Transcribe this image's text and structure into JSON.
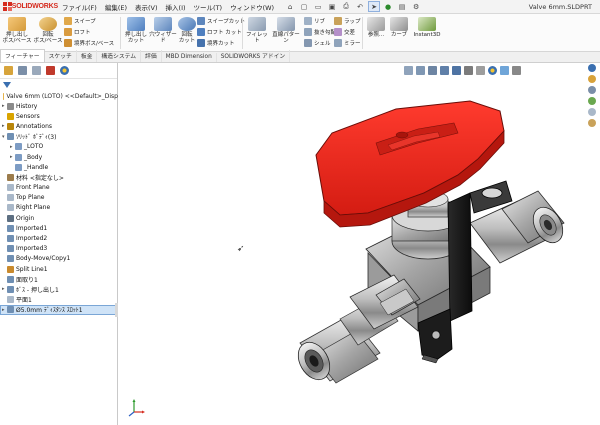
{
  "app": {
    "logo_text": "SOLIDWORKS",
    "window_title": "Valve 6mm.SLDPRT"
  },
  "menu": [
    {
      "label": "ファイル(F)"
    },
    {
      "label": "編集(E)"
    },
    {
      "label": "表示(V)"
    },
    {
      "label": "挿入(I)"
    },
    {
      "label": "ツール(T)"
    },
    {
      "label": "ウィンドウ(W)"
    }
  ],
  "ribbon": {
    "extrude_boss": "押し出し\nボス/ベース",
    "revolve_boss": "回転\nボス/ベース",
    "sweep": "スイープ",
    "loft": "ロフト",
    "boundary_boss": "境界ボス/ベース",
    "extruded_cut": "押し出し\nカット",
    "hole_wizard": "穴ウィザード",
    "revolved_cut": "回転\nカット",
    "swept_cut": "スイープカット",
    "lofted_cut": "ロフト カット",
    "boundary_cut": "境界カット",
    "fillet": "フィレット",
    "linear_pattern": "直線パターン",
    "rib": "リブ",
    "draft": "抜き勾配",
    "shell": "シェル",
    "wrap": "ラップ",
    "intersect": "交差",
    "mirror": "ミラー",
    "reference_geometry": "参照...",
    "curves": "カーブ",
    "instant3d": "Instant3D"
  },
  "tabs": [
    {
      "label": "フィーチャー",
      "active": true
    },
    {
      "label": "スケッチ",
      "active": false
    },
    {
      "label": "板金",
      "active": false
    },
    {
      "label": "構造システム",
      "active": false
    },
    {
      "label": "評価",
      "active": false
    },
    {
      "label": "MBD Dimension",
      "active": false
    },
    {
      "label": "SOLIDWORKS アドイン",
      "active": false
    }
  ],
  "tree": {
    "root": "Valve 6mm (LOTO) <<Default>_Disp",
    "items": [
      {
        "label": "History",
        "indent": 1,
        "toggle": "▸",
        "icon_color": "#8a8a8a"
      },
      {
        "label": "Sensors",
        "indent": 1,
        "toggle": "",
        "icon_color": "#d9a400"
      },
      {
        "label": "Annotations",
        "indent": 1,
        "toggle": "▸",
        "icon_color": "#b8860b"
      },
      {
        "label": "ｿﾘｯﾄﾞ ﾎﾞﾃﾞｨ(3)",
        "indent": 1,
        "toggle": "▾",
        "icon_color": "#6f8fb3"
      },
      {
        "label": "_LOTO",
        "indent": 2,
        "toggle": "▸",
        "icon_color": "#7d9cc4"
      },
      {
        "label": "_Body",
        "indent": 2,
        "toggle": "▸",
        "icon_color": "#7d9cc4"
      },
      {
        "label": "_Handle",
        "indent": 2,
        "toggle": "",
        "icon_color": "#7d9cc4"
      },
      {
        "label": "材料 <指定なし>",
        "indent": 1,
        "toggle": "",
        "icon_color": "#9c7c4c"
      },
      {
        "label": "Front Plane",
        "indent": 1,
        "toggle": "",
        "icon_color": "#a9b8c9"
      },
      {
        "label": "Top Plane",
        "indent": 1,
        "toggle": "",
        "icon_color": "#a9b8c9"
      },
      {
        "label": "Right Plane",
        "indent": 1,
        "toggle": "",
        "icon_color": "#a9b8c9"
      },
      {
        "label": "Origin",
        "indent": 1,
        "toggle": "",
        "icon_color": "#5d6f82"
      },
      {
        "label": "Imported1",
        "indent": 1,
        "toggle": "",
        "icon_color": "#6f8fb3"
      },
      {
        "label": "Imported2",
        "indent": 1,
        "toggle": "",
        "icon_color": "#6f8fb3"
      },
      {
        "label": "Imported3",
        "indent": 1,
        "toggle": "",
        "icon_color": "#6f8fb3"
      },
      {
        "label": "Body-Move/Copy1",
        "indent": 1,
        "toggle": "",
        "icon_color": "#6f8fb3"
      },
      {
        "label": "Split Line1",
        "indent": 1,
        "toggle": "",
        "icon_color": "#c98a2d"
      },
      {
        "label": "面取り1",
        "indent": 1,
        "toggle": "",
        "icon_color": "#6f8fb3"
      },
      {
        "label": "ﾎﾞｽ - 押し出し1",
        "indent": 1,
        "toggle": "▸",
        "icon_color": "#6f8fb3"
      },
      {
        "label": "平面1",
        "indent": 1,
        "toggle": "",
        "icon_color": "#a9b8c9"
      },
      {
        "label": "Ø5.0mm ﾃﾞｨｽﾀﾝｽ ｽﾛｯﾄ1",
        "indent": 1,
        "toggle": "▸",
        "icon_color": "#6f8fb3",
        "selected": true
      }
    ]
  },
  "colors": {
    "handle_red": "#e8231a",
    "selection": "#cfe3f7",
    "accent_blue": "#3a6fb0"
  }
}
